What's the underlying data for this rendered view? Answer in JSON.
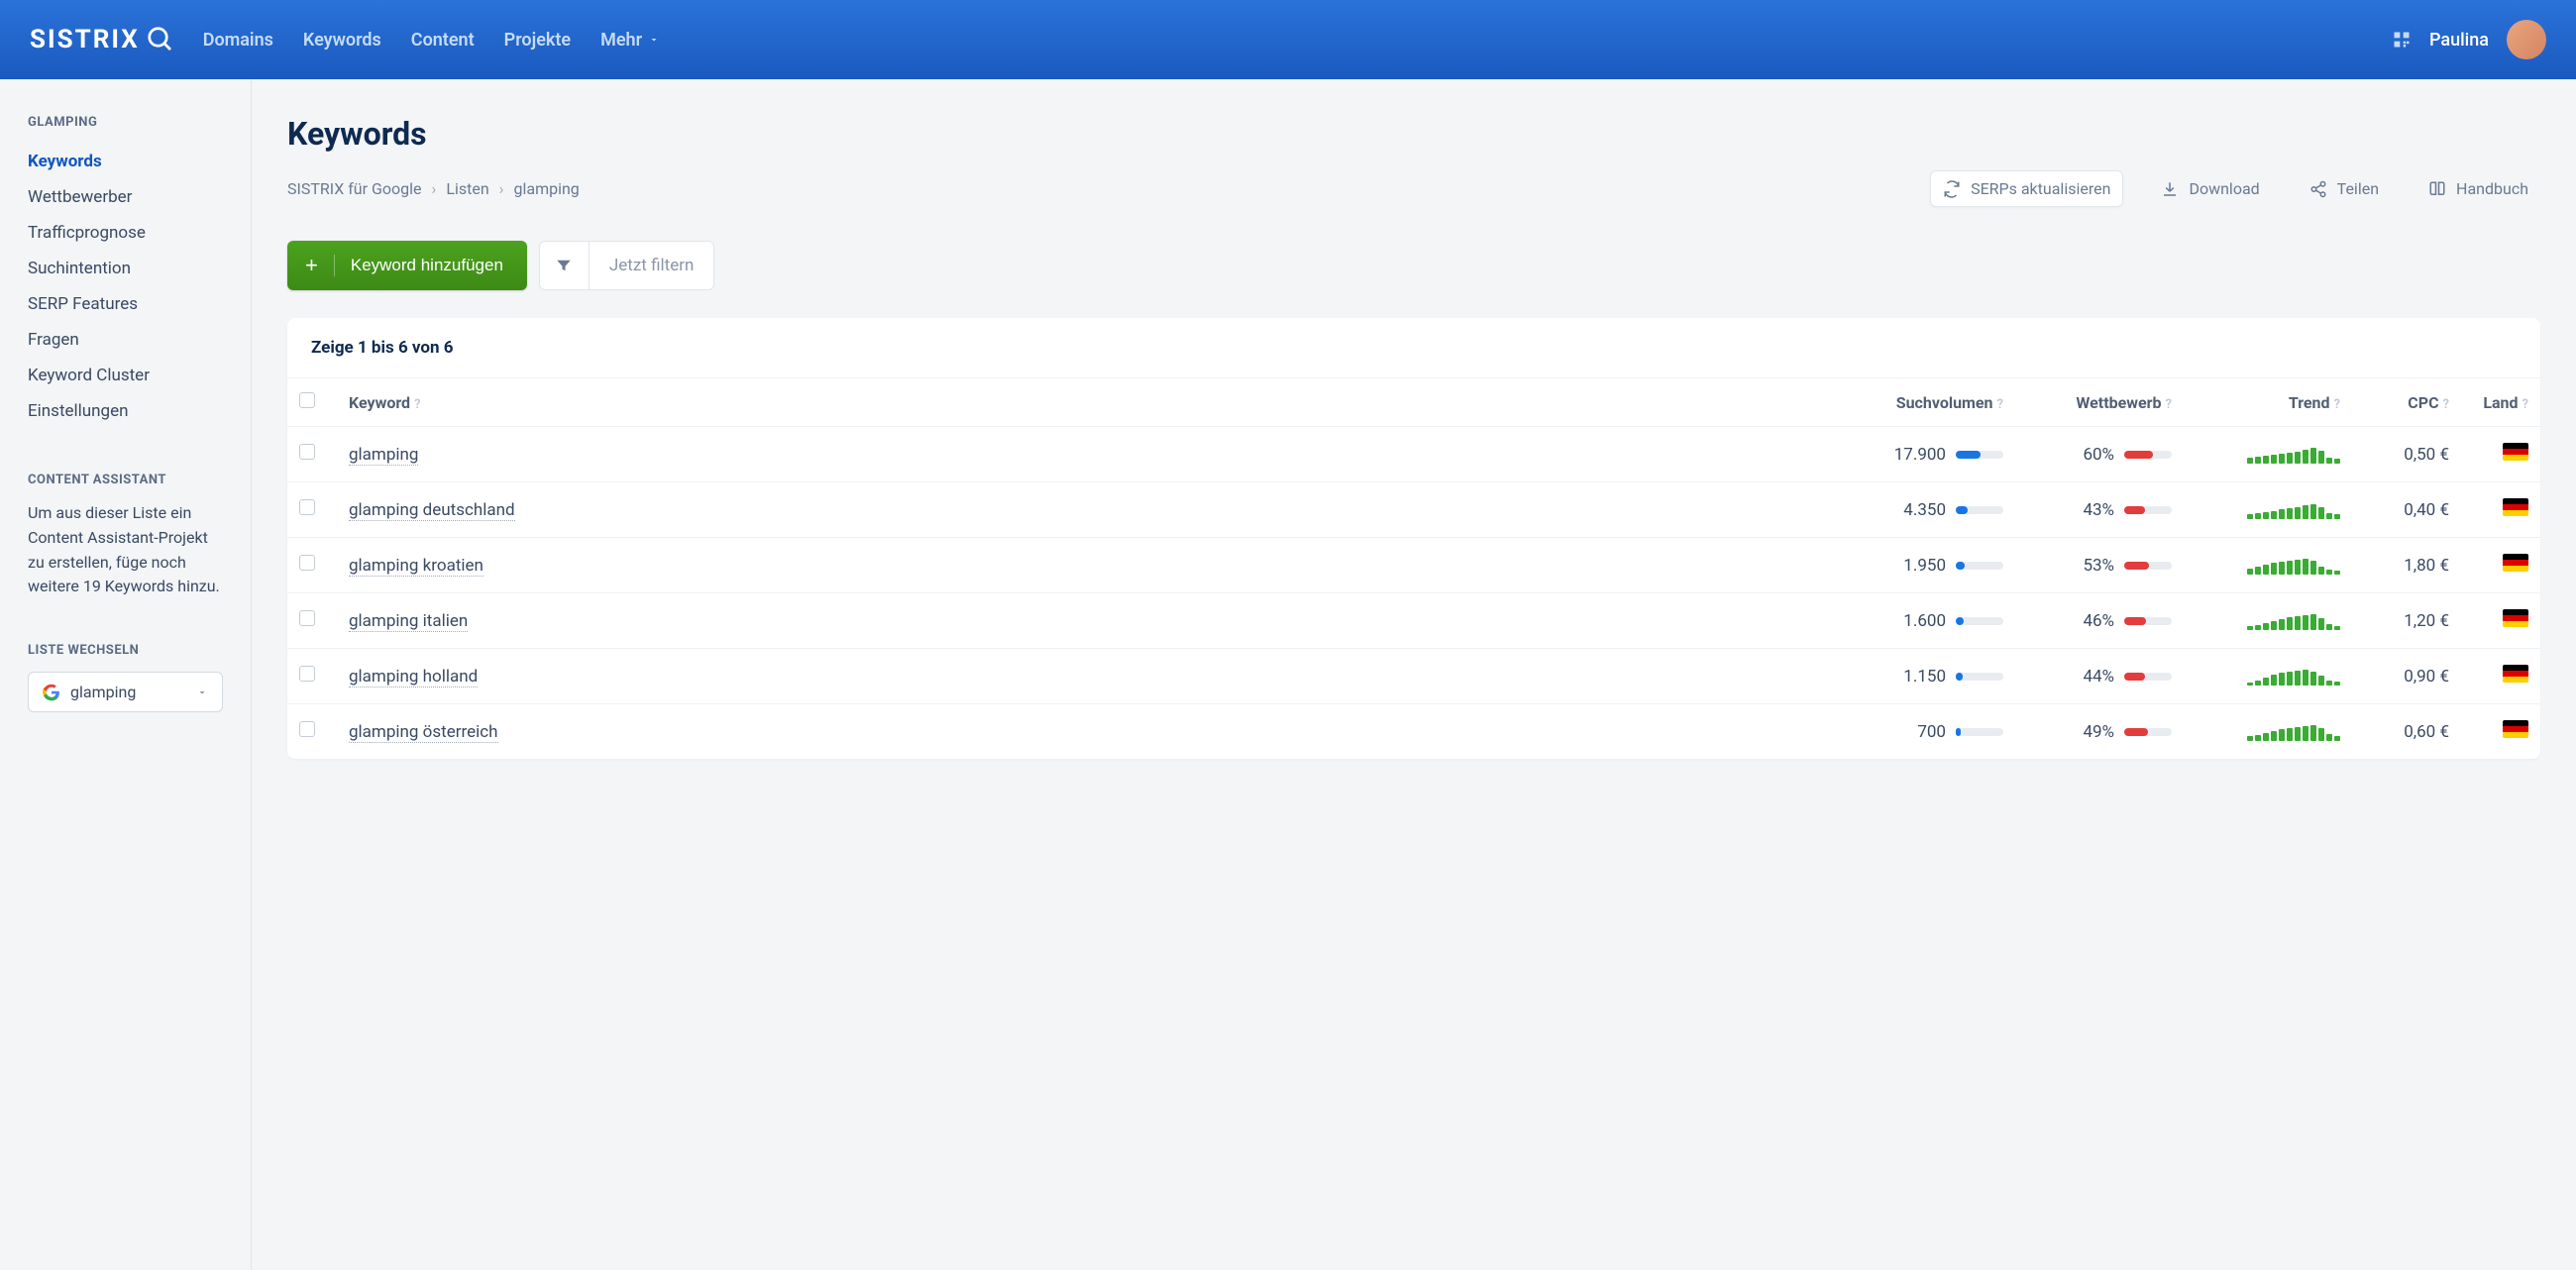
{
  "header": {
    "brand": "SISTRIX",
    "nav": [
      "Domains",
      "Keywords",
      "Content",
      "Projekte",
      "Mehr"
    ],
    "username": "Paulina"
  },
  "sidebar": {
    "section_title": "GLAMPING",
    "items": [
      "Keywords",
      "Wettbewerber",
      "Trafficprognose",
      "Suchintention",
      "SERP Features",
      "Fragen",
      "Keyword Cluster",
      "Einstellungen"
    ],
    "active_index": 0,
    "assistant_title": "CONTENT ASSISTANT",
    "assistant_text": "Um aus dieser Liste ein Content Assistant-Projekt zu erstellen, füge noch weitere 19 Keywords hinzu.",
    "list_switch_title": "LISTE WECHSELN",
    "list_name": "glamping"
  },
  "page": {
    "title": "Keywords",
    "breadcrumbs": [
      "SISTRIX für Google",
      "Listen",
      "glamping"
    ],
    "actions": {
      "refresh": "SERPs aktualisieren",
      "download": "Download",
      "share": "Teilen",
      "handbook": "Handbuch"
    },
    "add_keyword": "Keyword hinzufügen",
    "filter_label": "Jetzt filtern",
    "count_label": "Zeige 1 bis 6 von 6",
    "columns": {
      "keyword": "Keyword",
      "volume": "Suchvolumen",
      "competition": "Wettbewerb",
      "trend": "Trend",
      "cpc": "CPC",
      "country": "Land"
    },
    "rows": [
      {
        "keyword": "glamping",
        "volume": "17.900",
        "vol_pct": 52,
        "competition": "60%",
        "comp_pct": 60,
        "cpc": "0,50 €",
        "trend": [
          6,
          7,
          8,
          9,
          10,
          11,
          12,
          14,
          16,
          13,
          6,
          5
        ]
      },
      {
        "keyword": "glamping deutschland",
        "volume": "4.350",
        "vol_pct": 24,
        "competition": "43%",
        "comp_pct": 43,
        "cpc": "0,40 €",
        "trend": [
          5,
          6,
          7,
          8,
          10,
          11,
          12,
          14,
          15,
          12,
          6,
          5
        ]
      },
      {
        "keyword": "glamping kroatien",
        "volume": "1.950",
        "vol_pct": 18,
        "competition": "53%",
        "comp_pct": 53,
        "cpc": "1,80 €",
        "trend": [
          6,
          8,
          10,
          12,
          13,
          14,
          15,
          16,
          14,
          8,
          5,
          4
        ]
      },
      {
        "keyword": "glamping italien",
        "volume": "1.600",
        "vol_pct": 16,
        "competition": "46%",
        "comp_pct": 46,
        "cpc": "1,20 €",
        "trend": [
          4,
          5,
          7,
          9,
          11,
          13,
          14,
          15,
          16,
          12,
          6,
          4
        ]
      },
      {
        "keyword": "glamping holland",
        "volume": "1.150",
        "vol_pct": 14,
        "competition": "44%",
        "comp_pct": 44,
        "cpc": "0,90 €",
        "trend": [
          3,
          5,
          8,
          11,
          13,
          14,
          15,
          16,
          14,
          10,
          5,
          4
        ]
      },
      {
        "keyword": "glamping österreich",
        "volume": "700",
        "vol_pct": 10,
        "competition": "49%",
        "comp_pct": 49,
        "cpc": "0,60 €",
        "trend": [
          5,
          6,
          8,
          10,
          12,
          13,
          14,
          15,
          16,
          13,
          7,
          5
        ]
      }
    ]
  }
}
